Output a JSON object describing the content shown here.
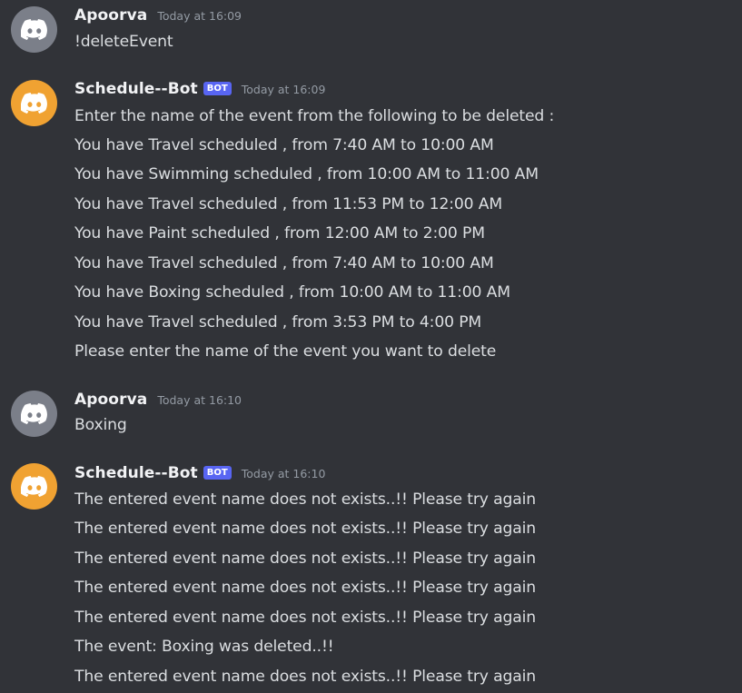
{
  "colors": {
    "background": "#313338",
    "text": "#dbdee1",
    "username": "#f2f3f5",
    "timestamp": "#949ba4",
    "bot_tag": "#5865f2",
    "user_avatar": "#7b7f89",
    "bot_avatar": "#f0a232"
  },
  "messages": [
    {
      "author": "Apoorva",
      "avatar_icon": "discord-logo-icon",
      "is_bot": false,
      "timestamp": "Today at 16:09",
      "lines": [
        "!deleteEvent"
      ]
    },
    {
      "author": "Schedule--Bot",
      "avatar_icon": "discord-logo-icon",
      "is_bot": true,
      "bot_tag": "BOT",
      "timestamp": "Today at 16:09",
      "lines": [
        "Enter the name of the event from the following to be deleted :",
        "You have Travel scheduled , from 7:40 AM to 10:00 AM",
        "You have Swimming scheduled , from 10:00 AM to 11:00 AM",
        "You have Travel scheduled , from 11:53 PM to 12:00 AM",
        "You have Paint scheduled , from 12:00 AM to 2:00 PM",
        "You have Travel scheduled , from 7:40 AM to 10:00 AM",
        "You have Boxing scheduled , from 10:00 AM to 11:00 AM",
        "You have Travel scheduled , from 3:53 PM to 4:00 PM",
        "Please enter the name of the event you want to delete"
      ]
    },
    {
      "author": "Apoorva",
      "avatar_icon": "discord-logo-icon",
      "is_bot": false,
      "timestamp": "Today at 16:10",
      "lines": [
        "Boxing"
      ]
    },
    {
      "author": "Schedule--Bot",
      "avatar_icon": "discord-logo-icon",
      "is_bot": true,
      "bot_tag": "BOT",
      "timestamp": "Today at 16:10",
      "lines": [
        "The entered event name does not exists..!! Please try again",
        "The entered event name does not exists..!! Please try again",
        "The entered event name does not exists..!! Please try again",
        "The entered event name does not exists..!! Please try again",
        "The entered event name does not exists..!! Please try again",
        "The event: Boxing was deleted..!!",
        "The entered event name does not exists..!! Please try again"
      ]
    }
  ]
}
